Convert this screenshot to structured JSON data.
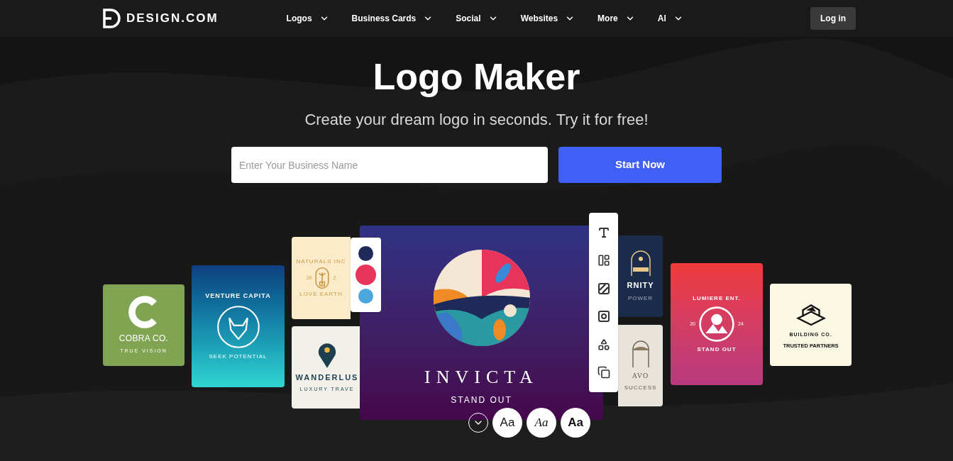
{
  "brand": {
    "name": "DESIGN.COM"
  },
  "nav": [
    {
      "label": "Logos"
    },
    {
      "label": "Business Cards"
    },
    {
      "label": "Social"
    },
    {
      "label": "Websites"
    },
    {
      "label": "More"
    },
    {
      "label": "AI"
    }
  ],
  "login": "Log in",
  "hero": {
    "title": "Logo Maker",
    "subtitle": "Create your dream logo in seconds. Try it for free!",
    "placeholder": "Enter Your Business Name",
    "button": "Start Now"
  },
  "cards": [
    {
      "kind": "cobra",
      "lines": [
        "COBRA CO.",
        "TRUE VISION"
      ]
    },
    {
      "kind": "venture",
      "lines": [
        "VENTURE CAPITA",
        "SEEK POTENTIAL"
      ]
    },
    {
      "kind": "naturals",
      "lines": [
        "NATURALS INC",
        "20",
        "2",
        "LOVE EARTH"
      ]
    },
    {
      "kind": "wanderlust",
      "lines": [
        "WANDERLUS",
        "LUXURY TRAVE"
      ]
    },
    {
      "kind": "eternity",
      "lines": [
        "RNITY",
        "POWER"
      ]
    },
    {
      "kind": "bravo",
      "lines": [
        "AVO",
        "SUCCESS"
      ]
    },
    {
      "kind": "lumiere",
      "lines": [
        "LUMIERE ENT.",
        "20",
        "24",
        "STAND OUT"
      ]
    },
    {
      "kind": "building",
      "lines": [
        "BUILDING CO.",
        "TRUSTED PARTNERS"
      ]
    }
  ],
  "editor": {
    "name": "INVICTA",
    "tagline": "STAND OUT",
    "swatches": [
      {
        "color": "#1e2a5a",
        "selected": false
      },
      {
        "color": "#e8345a",
        "selected": true
      },
      {
        "color": "#4ca6dc",
        "selected": false
      }
    ],
    "tools": [
      {
        "kind": "text"
      },
      {
        "kind": "layout"
      },
      {
        "kind": "pattern"
      },
      {
        "kind": "frame"
      },
      {
        "kind": "shapes"
      },
      {
        "kind": "copy"
      }
    ],
    "fonts": [
      {
        "kind": "regular",
        "label": "Aa"
      },
      {
        "kind": "italic",
        "label": "Aa"
      },
      {
        "kind": "bold",
        "label": "Aa"
      }
    ]
  }
}
